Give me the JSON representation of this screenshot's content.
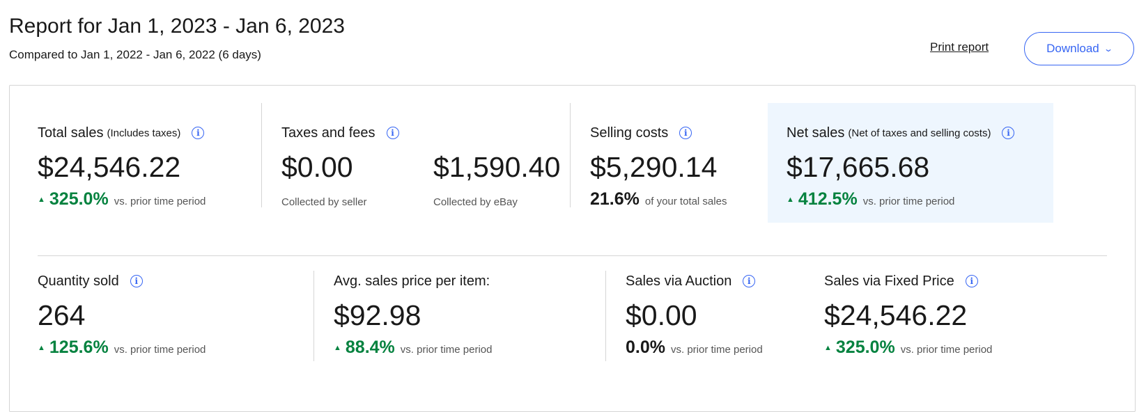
{
  "header": {
    "title": "Report for Jan 1, 2023 - Jan 6, 2023",
    "subtitle": "Compared to Jan 1, 2022 - Jan 6, 2022 (6 days)",
    "print_label": "Print report",
    "download_label": "Download",
    "download_chevron": "⌄"
  },
  "row1": {
    "total_sales": {
      "label": "Total sales",
      "sublabel": "(Includes taxes)",
      "value": "$24,546.22",
      "pct": "325.0%",
      "note": "vs. prior time period"
    },
    "taxes": {
      "label": "Taxes and fees",
      "seller_value": "$0.00",
      "seller_caption": "Collected by seller",
      "ebay_value": "$1,590.40",
      "ebay_caption": "Collected by eBay"
    },
    "selling_costs": {
      "label": "Selling costs",
      "value": "$5,290.14",
      "pct": "21.6%",
      "note": "of your total sales"
    },
    "net_sales": {
      "label": "Net sales",
      "sublabel": "(Net of taxes and selling costs)",
      "value": "$17,665.68",
      "pct": "412.5%",
      "note": "vs. prior time period"
    }
  },
  "row2": {
    "quantity": {
      "label": "Quantity sold",
      "value": "264",
      "pct": "125.6%",
      "note": "vs. prior time period"
    },
    "avg_price": {
      "label": "Avg. sales price per item:",
      "value": "$92.98",
      "pct": "88.4%",
      "note": "vs. prior time period"
    },
    "auction": {
      "label": "Sales via Auction",
      "value": "$0.00",
      "pct": "0.0%",
      "note": "vs. prior time period"
    },
    "fixed": {
      "label": "Sales via Fixed Price",
      "value": "$24,546.22",
      "pct": "325.0%",
      "note": "vs. prior time period"
    }
  },
  "icons": {
    "info": "info-icon",
    "trend_up": "triangle-up-icon"
  },
  "colors": {
    "accent": "#3665f3",
    "positive": "#05823f",
    "highlight_bg": "#eef6fe"
  }
}
